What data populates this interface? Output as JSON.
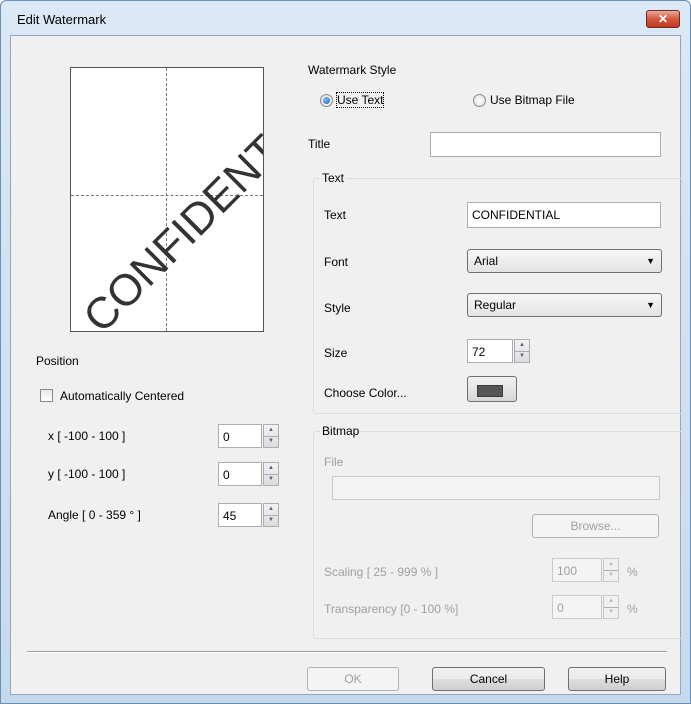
{
  "window": {
    "title": "Edit Watermark",
    "close_glyph": "✕"
  },
  "preview": {
    "watermark_text": "CONFIDENTIAL",
    "angle": 45
  },
  "watermark_style": {
    "label": "Watermark Style",
    "use_text": "Use Text",
    "use_bitmap": "Use Bitmap File",
    "selected": "Use Text"
  },
  "title_field": {
    "label": "Title",
    "value": ""
  },
  "text_group": {
    "label": "Text",
    "text_label": "Text",
    "text_value": "CONFIDENTIAL",
    "font_label": "Font",
    "font_value": "Arial",
    "style_label": "Style",
    "style_value": "Regular",
    "size_label": "Size",
    "size_value": "72",
    "color_label": "Choose Color...",
    "color_value": "#555555"
  },
  "bitmap_group": {
    "label": "Bitmap",
    "file_label": "File",
    "file_value": "",
    "browse_label": "Browse...",
    "scaling_label": "Scaling [ 25 - 999 % ]",
    "scaling_value": "100",
    "scaling_unit": "%",
    "transparency_label": "Transparency [0 - 100 %]",
    "transparency_value": "0",
    "transparency_unit": "%"
  },
  "position": {
    "label": "Position",
    "auto_centered_label": "Automatically Centered",
    "auto_centered": false,
    "x_label": "x [ -100  -  100 ]",
    "x_value": "0",
    "y_label": "y [ -100  -  100 ]",
    "y_value": "0",
    "angle_label": "Angle [ 0 - 359 ° ]",
    "angle_value": "45"
  },
  "buttons": {
    "ok": "OK",
    "cancel": "Cancel",
    "help": "Help"
  }
}
